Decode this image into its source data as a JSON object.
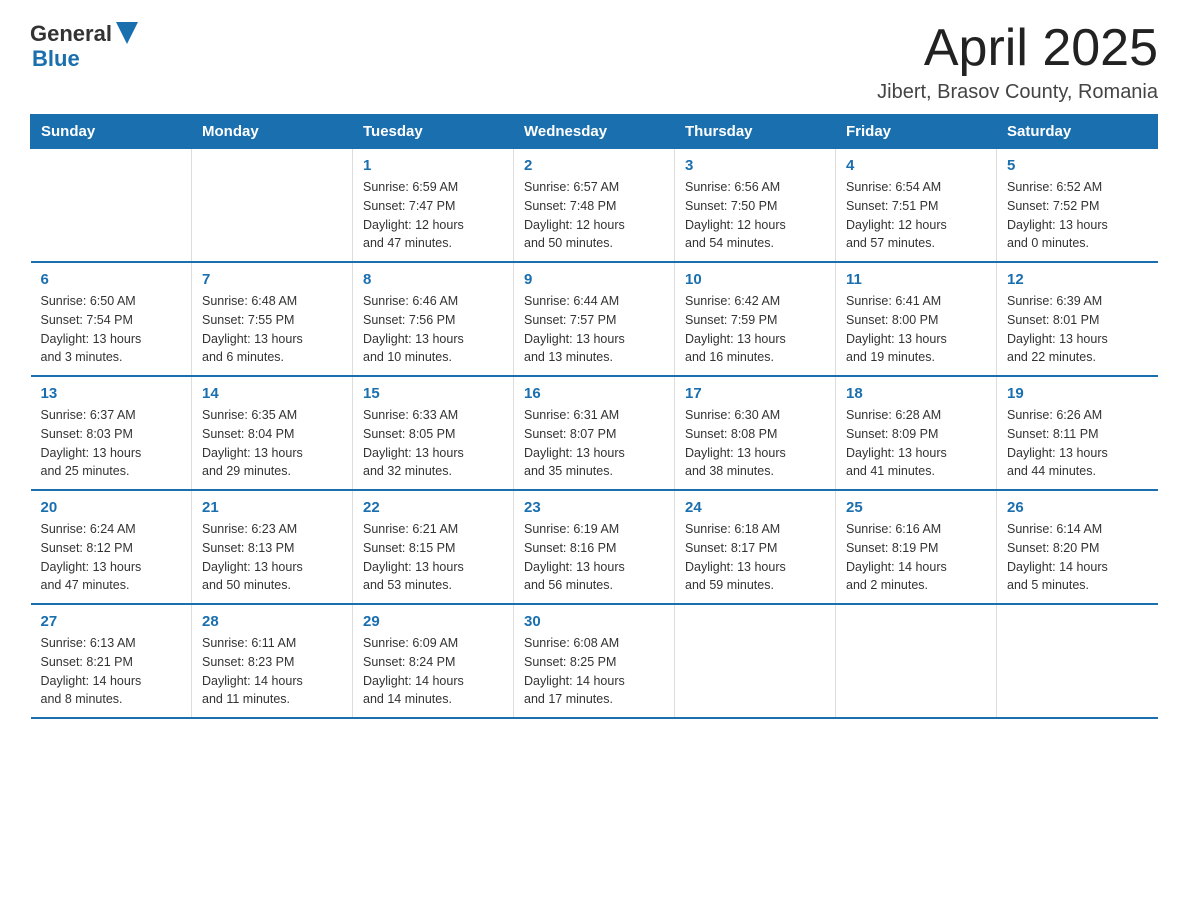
{
  "logo": {
    "text_general": "General",
    "text_blue": "Blue"
  },
  "title": "April 2025",
  "subtitle": "Jibert, Brasov County, Romania",
  "days_of_week": [
    "Sunday",
    "Monday",
    "Tuesday",
    "Wednesday",
    "Thursday",
    "Friday",
    "Saturday"
  ],
  "weeks": [
    [
      {
        "day": "",
        "info": ""
      },
      {
        "day": "",
        "info": ""
      },
      {
        "day": "1",
        "info": "Sunrise: 6:59 AM\nSunset: 7:47 PM\nDaylight: 12 hours\nand 47 minutes."
      },
      {
        "day": "2",
        "info": "Sunrise: 6:57 AM\nSunset: 7:48 PM\nDaylight: 12 hours\nand 50 minutes."
      },
      {
        "day": "3",
        "info": "Sunrise: 6:56 AM\nSunset: 7:50 PM\nDaylight: 12 hours\nand 54 minutes."
      },
      {
        "day": "4",
        "info": "Sunrise: 6:54 AM\nSunset: 7:51 PM\nDaylight: 12 hours\nand 57 minutes."
      },
      {
        "day": "5",
        "info": "Sunrise: 6:52 AM\nSunset: 7:52 PM\nDaylight: 13 hours\nand 0 minutes."
      }
    ],
    [
      {
        "day": "6",
        "info": "Sunrise: 6:50 AM\nSunset: 7:54 PM\nDaylight: 13 hours\nand 3 minutes."
      },
      {
        "day": "7",
        "info": "Sunrise: 6:48 AM\nSunset: 7:55 PM\nDaylight: 13 hours\nand 6 minutes."
      },
      {
        "day": "8",
        "info": "Sunrise: 6:46 AM\nSunset: 7:56 PM\nDaylight: 13 hours\nand 10 minutes."
      },
      {
        "day": "9",
        "info": "Sunrise: 6:44 AM\nSunset: 7:57 PM\nDaylight: 13 hours\nand 13 minutes."
      },
      {
        "day": "10",
        "info": "Sunrise: 6:42 AM\nSunset: 7:59 PM\nDaylight: 13 hours\nand 16 minutes."
      },
      {
        "day": "11",
        "info": "Sunrise: 6:41 AM\nSunset: 8:00 PM\nDaylight: 13 hours\nand 19 minutes."
      },
      {
        "day": "12",
        "info": "Sunrise: 6:39 AM\nSunset: 8:01 PM\nDaylight: 13 hours\nand 22 minutes."
      }
    ],
    [
      {
        "day": "13",
        "info": "Sunrise: 6:37 AM\nSunset: 8:03 PM\nDaylight: 13 hours\nand 25 minutes."
      },
      {
        "day": "14",
        "info": "Sunrise: 6:35 AM\nSunset: 8:04 PM\nDaylight: 13 hours\nand 29 minutes."
      },
      {
        "day": "15",
        "info": "Sunrise: 6:33 AM\nSunset: 8:05 PM\nDaylight: 13 hours\nand 32 minutes."
      },
      {
        "day": "16",
        "info": "Sunrise: 6:31 AM\nSunset: 8:07 PM\nDaylight: 13 hours\nand 35 minutes."
      },
      {
        "day": "17",
        "info": "Sunrise: 6:30 AM\nSunset: 8:08 PM\nDaylight: 13 hours\nand 38 minutes."
      },
      {
        "day": "18",
        "info": "Sunrise: 6:28 AM\nSunset: 8:09 PM\nDaylight: 13 hours\nand 41 minutes."
      },
      {
        "day": "19",
        "info": "Sunrise: 6:26 AM\nSunset: 8:11 PM\nDaylight: 13 hours\nand 44 minutes."
      }
    ],
    [
      {
        "day": "20",
        "info": "Sunrise: 6:24 AM\nSunset: 8:12 PM\nDaylight: 13 hours\nand 47 minutes."
      },
      {
        "day": "21",
        "info": "Sunrise: 6:23 AM\nSunset: 8:13 PM\nDaylight: 13 hours\nand 50 minutes."
      },
      {
        "day": "22",
        "info": "Sunrise: 6:21 AM\nSunset: 8:15 PM\nDaylight: 13 hours\nand 53 minutes."
      },
      {
        "day": "23",
        "info": "Sunrise: 6:19 AM\nSunset: 8:16 PM\nDaylight: 13 hours\nand 56 minutes."
      },
      {
        "day": "24",
        "info": "Sunrise: 6:18 AM\nSunset: 8:17 PM\nDaylight: 13 hours\nand 59 minutes."
      },
      {
        "day": "25",
        "info": "Sunrise: 6:16 AM\nSunset: 8:19 PM\nDaylight: 14 hours\nand 2 minutes."
      },
      {
        "day": "26",
        "info": "Sunrise: 6:14 AM\nSunset: 8:20 PM\nDaylight: 14 hours\nand 5 minutes."
      }
    ],
    [
      {
        "day": "27",
        "info": "Sunrise: 6:13 AM\nSunset: 8:21 PM\nDaylight: 14 hours\nand 8 minutes."
      },
      {
        "day": "28",
        "info": "Sunrise: 6:11 AM\nSunset: 8:23 PM\nDaylight: 14 hours\nand 11 minutes."
      },
      {
        "day": "29",
        "info": "Sunrise: 6:09 AM\nSunset: 8:24 PM\nDaylight: 14 hours\nand 14 minutes."
      },
      {
        "day": "30",
        "info": "Sunrise: 6:08 AM\nSunset: 8:25 PM\nDaylight: 14 hours\nand 17 minutes."
      },
      {
        "day": "",
        "info": ""
      },
      {
        "day": "",
        "info": ""
      },
      {
        "day": "",
        "info": ""
      }
    ]
  ]
}
